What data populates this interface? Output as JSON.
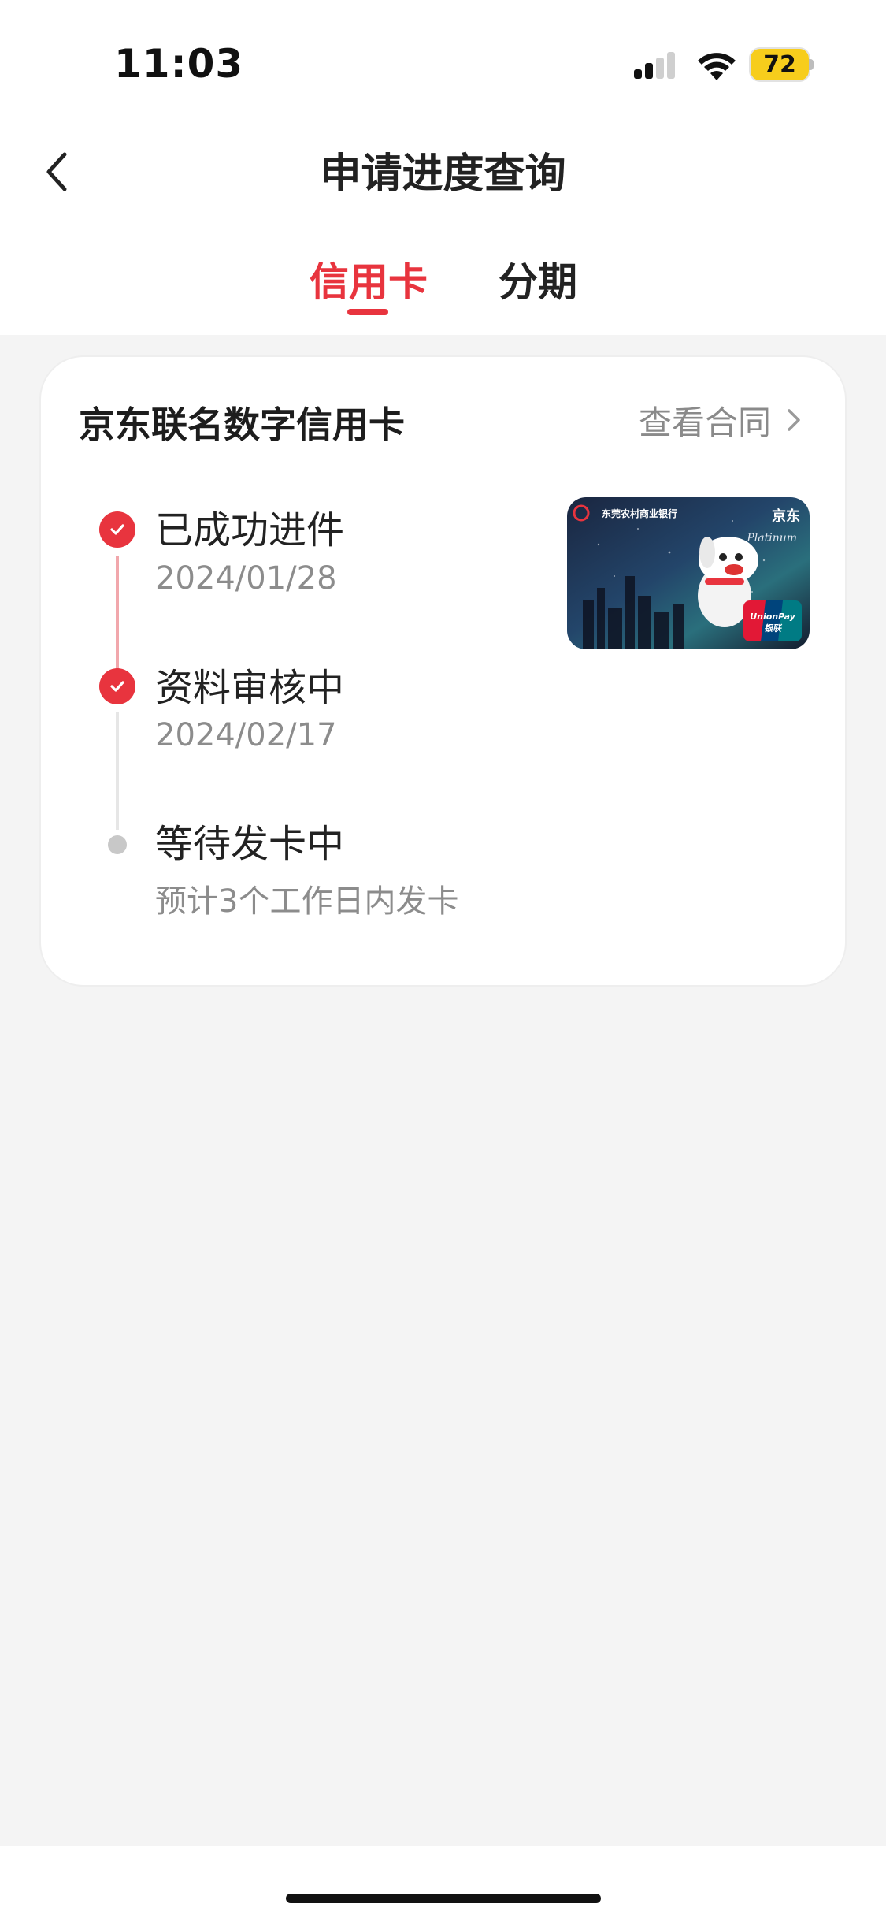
{
  "status_bar": {
    "time": "11:03",
    "battery": "72"
  },
  "nav": {
    "title": "申请进度查询"
  },
  "tabs": [
    {
      "label": "信用卡",
      "active": true
    },
    {
      "label": "分期",
      "active": false
    }
  ],
  "card": {
    "title": "京东联名数字信用卡",
    "contract_link": "查看合同",
    "steps": [
      {
        "title": "已成功进件",
        "subtitle": "2024/01/28",
        "status": "done"
      },
      {
        "title": "资料审核中",
        "subtitle": "2024/02/17",
        "status": "done"
      },
      {
        "title": "等待发卡中",
        "subtitle": "预计3个工作日内发卡",
        "status": "pending"
      }
    ]
  },
  "colors": {
    "accent": "#e8343e",
    "background": "#f4f4f4"
  },
  "icons": {
    "back": "chevron-left-icon",
    "contract": "chevron-right-icon",
    "done": "check-circle-icon",
    "pending": "dot-icon"
  }
}
